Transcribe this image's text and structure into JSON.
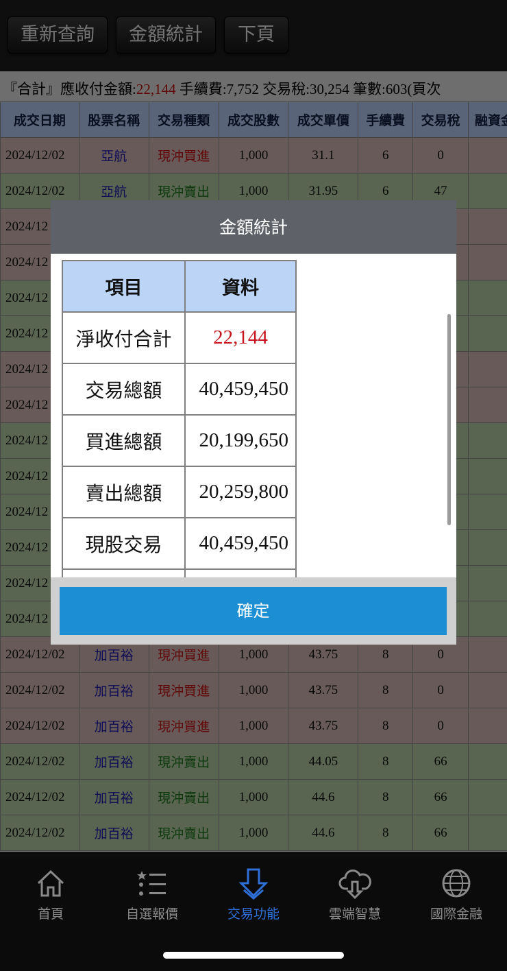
{
  "toolbar": {
    "requery": "重新查詢",
    "amount_stats": "金額統計",
    "next_page": "下頁"
  },
  "summary": {
    "prefix": "『合計』應收付金額:",
    "amount": "22,144",
    "rest": " 手續費:7,752 交易稅:30,254 筆數:603(頁次"
  },
  "table": {
    "headers": [
      "成交日期",
      "股票名稱",
      "交易種類",
      "成交股數",
      "成交單價",
      "手續費",
      "交易稅",
      "融資金"
    ],
    "rows": [
      {
        "date": "2024/12/02",
        "stock": "亞航",
        "type": "現沖買進",
        "side": "buy",
        "qty": "1,000",
        "price": "31.1",
        "fee": "6",
        "tax": "0"
      },
      {
        "date": "2024/12/02",
        "stock": "亞航",
        "type": "現沖賣出",
        "side": "sell",
        "qty": "1,000",
        "price": "31.95",
        "fee": "6",
        "tax": "47"
      },
      {
        "date": "2024/12",
        "stock": "",
        "type": "",
        "side": "buy",
        "qty": "",
        "price": "",
        "fee": "",
        "tax": ""
      },
      {
        "date": "2024/12",
        "stock": "",
        "type": "",
        "side": "buy",
        "qty": "",
        "price": "",
        "fee": "",
        "tax": ""
      },
      {
        "date": "2024/12",
        "stock": "",
        "type": "",
        "side": "sell",
        "qty": "",
        "price": "",
        "fee": "",
        "tax": ""
      },
      {
        "date": "2024/12",
        "stock": "",
        "type": "",
        "side": "sell",
        "qty": "",
        "price": "",
        "fee": "",
        "tax": ""
      },
      {
        "date": "2024/12",
        "stock": "",
        "type": "",
        "side": "buy",
        "qty": "",
        "price": "",
        "fee": "",
        "tax": ""
      },
      {
        "date": "2024/12",
        "stock": "",
        "type": "",
        "side": "buy",
        "qty": "",
        "price": "",
        "fee": "",
        "tax": ""
      },
      {
        "date": "2024/12",
        "stock": "",
        "type": "",
        "side": "sell",
        "qty": "",
        "price": "",
        "fee": "",
        "tax": ""
      },
      {
        "date": "2024/12",
        "stock": "",
        "type": "",
        "side": "sell",
        "qty": "",
        "price": "",
        "fee": "",
        "tax": ""
      },
      {
        "date": "2024/12",
        "stock": "",
        "type": "",
        "side": "sell",
        "qty": "",
        "price": "",
        "fee": "",
        "tax": ""
      },
      {
        "date": "2024/12",
        "stock": "",
        "type": "",
        "side": "sell",
        "qty": "",
        "price": "",
        "fee": "",
        "tax": ""
      },
      {
        "date": "2024/12",
        "stock": "",
        "type": "",
        "side": "sell",
        "qty": "",
        "price": "",
        "fee": "",
        "tax": ""
      },
      {
        "date": "2024/12",
        "stock": "",
        "type": "",
        "side": "sell",
        "qty": "",
        "price": "",
        "fee": "",
        "tax": ""
      },
      {
        "date": "2024/12/02",
        "stock": "加百裕",
        "type": "現沖買進",
        "side": "buy",
        "qty": "1,000",
        "price": "43.75",
        "fee": "8",
        "tax": "0"
      },
      {
        "date": "2024/12/02",
        "stock": "加百裕",
        "type": "現沖買進",
        "side": "buy",
        "qty": "1,000",
        "price": "43.75",
        "fee": "8",
        "tax": "0"
      },
      {
        "date": "2024/12/02",
        "stock": "加百裕",
        "type": "現沖買進",
        "side": "buy",
        "qty": "1,000",
        "price": "43.75",
        "fee": "8",
        "tax": "0"
      },
      {
        "date": "2024/12/02",
        "stock": "加百裕",
        "type": "現沖賣出",
        "side": "sell",
        "qty": "1,000",
        "price": "44.05",
        "fee": "8",
        "tax": "66"
      },
      {
        "date": "2024/12/02",
        "stock": "加百裕",
        "type": "現沖賣出",
        "side": "sell",
        "qty": "1,000",
        "price": "44.6",
        "fee": "8",
        "tax": "66"
      },
      {
        "date": "2024/12/02",
        "stock": "加百裕",
        "type": "現沖賣出",
        "side": "sell",
        "qty": "1,000",
        "price": "44.6",
        "fee": "8",
        "tax": "66"
      }
    ]
  },
  "dialog": {
    "title": "金額統計",
    "header_item": "項目",
    "header_value": "資料",
    "rows": [
      {
        "label": "淨收付合計",
        "value": "22,144"
      },
      {
        "label": "交易總額",
        "value": "40,459,450"
      },
      {
        "label": "買進總額",
        "value": "20,199,650"
      },
      {
        "label": "賣出總額",
        "value": "20,259,800"
      },
      {
        "label": "現股交易",
        "value": "40,459,450"
      }
    ],
    "ok": "確定"
  },
  "nav": {
    "items": [
      {
        "label": "首頁",
        "icon": "home-icon"
      },
      {
        "label": "自選報價",
        "icon": "star-list-icon"
      },
      {
        "label": "交易功能",
        "icon": "trade-arrow-icon"
      },
      {
        "label": "雲端智慧",
        "icon": "cloud-download-icon"
      },
      {
        "label": "國際金融",
        "icon": "globe-icon"
      }
    ],
    "active": "交易功能"
  },
  "colors": {
    "buy_row": "#d3b4b4",
    "sell_row": "#b5cba3",
    "header": "#b4c8f0",
    "accent": "#1c8fd4",
    "red": "#c01010",
    "green": "#187018"
  }
}
